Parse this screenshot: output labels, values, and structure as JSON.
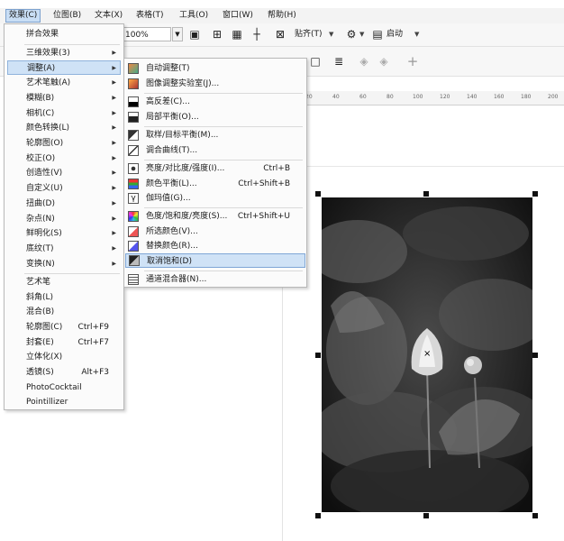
{
  "menubar": {
    "items": [
      "效果(C)",
      "位图(B)",
      "文本(X)",
      "表格(T)",
      "工具(O)",
      "窗口(W)",
      "帮助(H)"
    ]
  },
  "toolbar": {
    "zoom": "100%",
    "snap_label": "贴齐(T)",
    "launch_label": "启动"
  },
  "ruler": {
    "ticks": [
      "20",
      "40",
      "60",
      "80",
      "100",
      "120",
      "140",
      "160",
      "180",
      "200"
    ]
  },
  "effects_menu": {
    "items": [
      {
        "label": "拼合效果",
        "shortcut": ""
      },
      {
        "label": "三维效果(3)",
        "shortcut": ""
      },
      {
        "label": "调整(A)",
        "shortcut": ""
      },
      {
        "label": "艺术笔触(A)",
        "shortcut": ""
      },
      {
        "label": "模糊(B)",
        "shortcut": ""
      },
      {
        "label": "相机(C)",
        "shortcut": ""
      },
      {
        "label": "颜色转换(L)",
        "shortcut": ""
      },
      {
        "label": "轮廓图(O)",
        "shortcut": ""
      },
      {
        "label": "校正(O)",
        "shortcut": ""
      },
      {
        "label": "创造性(V)",
        "shortcut": ""
      },
      {
        "label": "自定义(U)",
        "shortcut": ""
      },
      {
        "label": "扭曲(D)",
        "shortcut": ""
      },
      {
        "label": "杂点(N)",
        "shortcut": ""
      },
      {
        "label": "鲜明化(S)",
        "shortcut": ""
      },
      {
        "label": "底纹(T)",
        "shortcut": ""
      },
      {
        "label": "变换(N)",
        "shortcut": ""
      },
      {
        "label": "艺术笔",
        "shortcut": ""
      },
      {
        "label": "斜角(L)",
        "shortcut": ""
      },
      {
        "label": "混合(B)",
        "shortcut": ""
      },
      {
        "label": "轮廓图(C)",
        "shortcut": "Ctrl+F9"
      },
      {
        "label": "封套(E)",
        "shortcut": "Ctrl+F7"
      },
      {
        "label": "立体化(X)",
        "shortcut": ""
      },
      {
        "label": "透镜(S)",
        "shortcut": "Alt+F3"
      },
      {
        "label": "PhotoCocktail",
        "shortcut": ""
      },
      {
        "label": "Pointillizer",
        "shortcut": ""
      }
    ]
  },
  "adjust_submenu": {
    "items": [
      {
        "label": "自动调整(T)",
        "shortcut": "",
        "icon": "auto-adjust-icon"
      },
      {
        "label": "图像调整实验室(J)...",
        "shortcut": "",
        "icon": "image-lab-icon"
      },
      {
        "label": "高反差(C)...",
        "shortcut": "",
        "icon": "high-contrast-icon"
      },
      {
        "label": "局部平衡(O)...",
        "shortcut": "",
        "icon": "local-equalize-icon"
      },
      {
        "label": "取样/目标平衡(M)...",
        "shortcut": "",
        "icon": "sample-target-icon"
      },
      {
        "label": "调合曲线(T)...",
        "shortcut": "",
        "icon": "tone-curve-icon"
      },
      {
        "label": "亮度/对比度/强度(I)...",
        "shortcut": "Ctrl+B",
        "icon": "brightness-icon"
      },
      {
        "label": "颜色平衡(L)...",
        "shortcut": "Ctrl+Shift+B",
        "icon": "color-balance-icon"
      },
      {
        "label": "伽玛值(G)...",
        "shortcut": "",
        "icon": "gamma-icon"
      },
      {
        "label": "色度/饱和度/亮度(S)...",
        "shortcut": "Ctrl+Shift+U",
        "icon": "hue-saturation-icon"
      },
      {
        "label": "所选颜色(V)...",
        "shortcut": "",
        "icon": "selective-color-icon"
      },
      {
        "label": "替换颜色(R)...",
        "shortcut": "",
        "icon": "replace-color-icon"
      },
      {
        "label": "取消饱和(D)",
        "shortcut": "",
        "icon": "desaturate-icon"
      },
      {
        "label": "通道混合器(N)...",
        "shortcut": "",
        "icon": "channel-mixer-icon"
      }
    ]
  }
}
